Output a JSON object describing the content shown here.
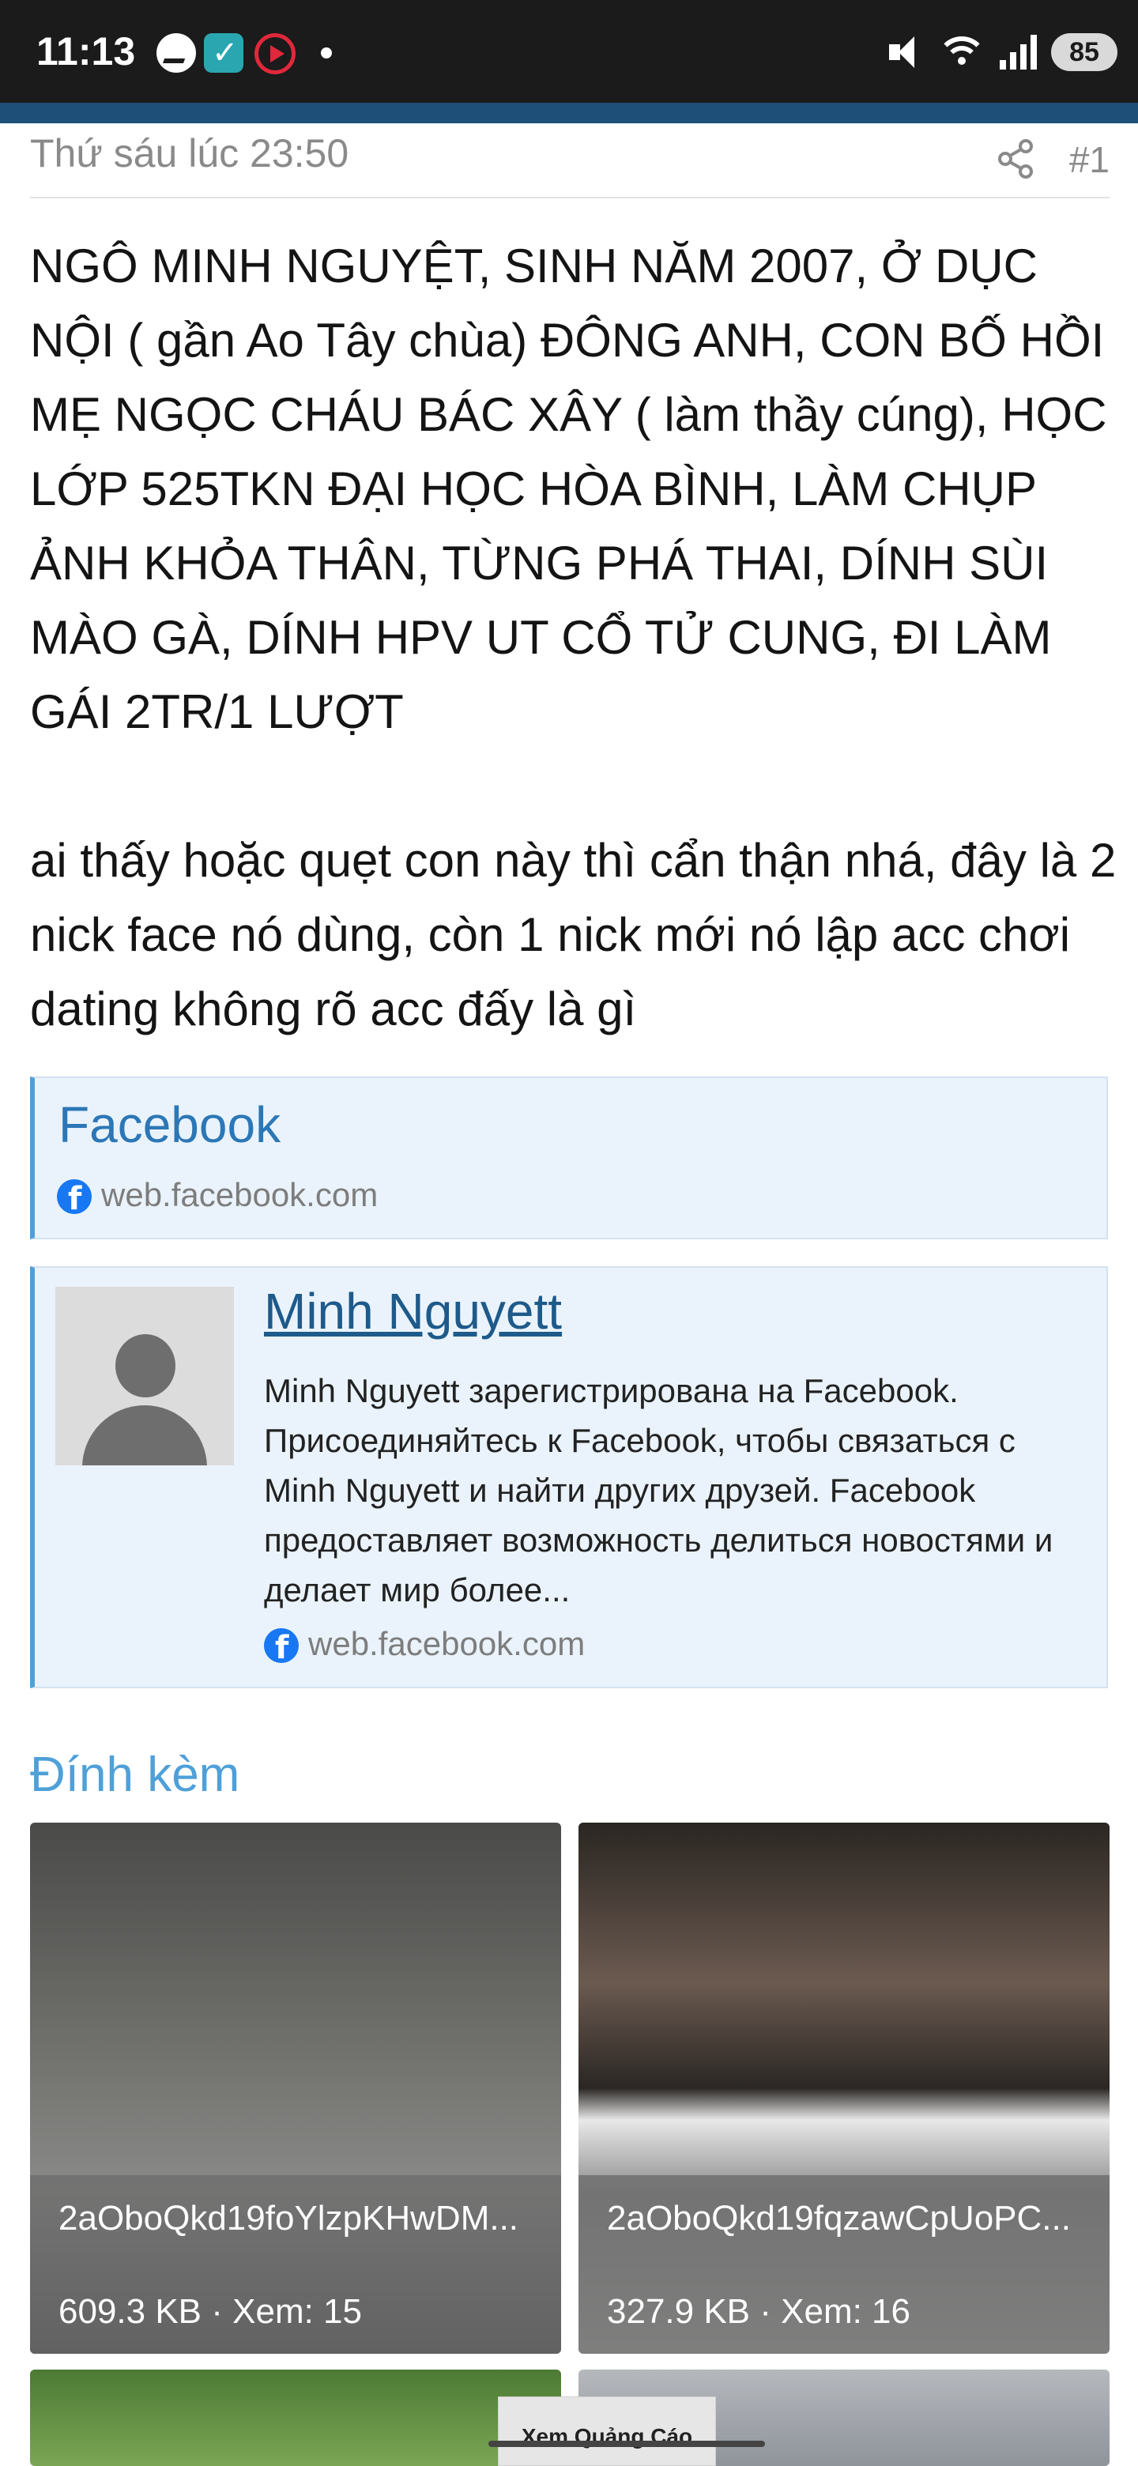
{
  "status_bar": {
    "time": "11:13",
    "battery": "85",
    "icons": [
      "messenger-icon",
      "check-app-icon",
      "play-app-icon",
      "notification-dot",
      "mute-icon",
      "wifi-icon",
      "signal-icon",
      "battery-icon"
    ]
  },
  "post": {
    "date": "Thứ sáu lúc 23:50",
    "number": "#1",
    "paragraph1": "NGÔ MINH NGUYỆT, SINH NĂM 2007, Ở DỤC NỘI ( gần Ao Tây chùa) ĐÔNG ANH, CON BỐ HỒI MẸ NGỌC CHÁU BÁC XÂY ( làm thầy cúng), HỌC LỚP 525TKN ĐẠI HỌC HÒA BÌNH, LÀM CHỤP ẢNH KHỎA THÂN, TỪNG PHÁ THAI, DÍNH SÙI MÀO GÀ, DÍNH HPV UT CỔ TỬ CUNG, ĐI LÀM GÁI 2TR/1 LƯỢT",
    "paragraph2": "ai thấy hoặc quẹt con này thì cẩn thận nhá, đây là 2 nick face nó dùng, còn 1 nick mới nó lập acc chơi dating không rõ acc đấy là gì"
  },
  "link_cards": [
    {
      "title": "Facebook",
      "domain": "web.facebook.com"
    },
    {
      "title": "Minh Nguyett",
      "description": "Minh Nguyett зарегистрирована на Facebook. Присоединяйтесь к Facebook, чтобы связаться с Minh Nguyett и найти других друзей. Facebook предоставляет возможность делиться новостями и делает мир более...",
      "domain": "web.facebook.com"
    }
  ],
  "attachments": {
    "heading": "Đính kèm",
    "items": [
      {
        "name": "2aOboQkd19foYlzpKHwDM...",
        "meta": "609.3 KB · Xem: 15"
      },
      {
        "name": "2aOboQkd19fqzawCpUoPC...",
        "meta": "327.9 KB · Xem: 16"
      }
    ]
  },
  "ad": {
    "label": "Xem Quảng Cáo"
  },
  "colors": {
    "accent": "#4fa0d8",
    "header_strip": "#1e4f78",
    "card_bg": "#eaf3fb",
    "link": "#1e5a8a"
  }
}
